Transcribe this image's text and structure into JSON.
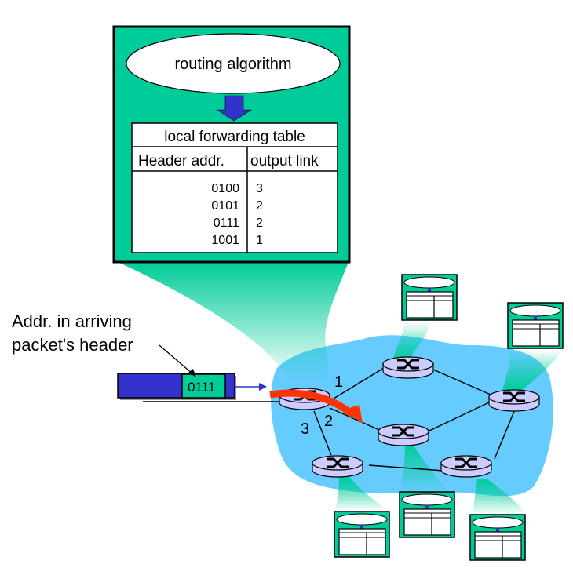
{
  "main_router_box": {
    "algorithm_label": "routing algorithm",
    "table_title": "local forwarding table",
    "col_header_addr": "Header addr.",
    "col_header_link": "output link",
    "rows": [
      {
        "addr": "0100",
        "link": "3"
      },
      {
        "addr": "0101",
        "link": "2"
      },
      {
        "addr": "0111",
        "link": "2"
      },
      {
        "addr": "1001",
        "link": "1"
      }
    ]
  },
  "annotation": {
    "line1": "Addr. in arriving",
    "line2": "packet's header"
  },
  "packet": {
    "header_value": "0111"
  },
  "link_labels": {
    "link1": "1",
    "link2": "2",
    "link3": "3"
  },
  "colors": {
    "box_green": "#00CC99",
    "cloud_blue": "#66CCFF",
    "router_fill": "#CCCCFF",
    "packet_blue": "#3333CC",
    "arrow_red": "#FF3300",
    "down_arrow_blue": "#3333CC"
  }
}
